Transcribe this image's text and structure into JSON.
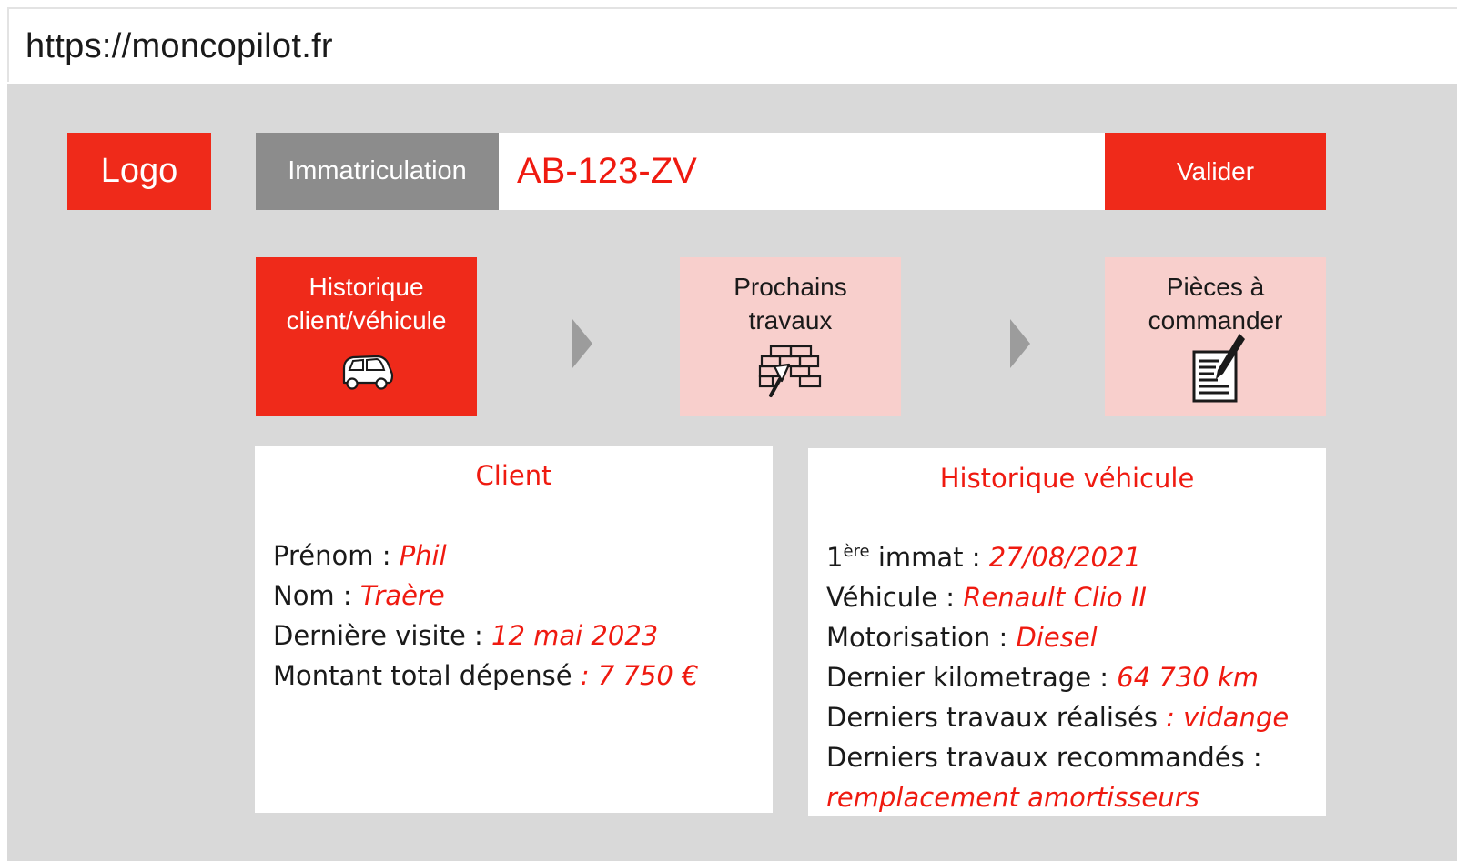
{
  "browser": {
    "url": "https://moncopilot.fr"
  },
  "header": {
    "logo_label": "Logo",
    "immat_label": "Immatriculation",
    "immat_value": "AB-123-ZV",
    "validate_label": "Valider"
  },
  "steps": [
    {
      "label": "Historique\nclient/véhicule",
      "icon": "car-icon",
      "active": true
    },
    {
      "label": "Prochains\ntravaux",
      "icon": "brick-wall-trowel-icon",
      "active": false
    },
    {
      "label": "Pièces à\ncommander",
      "icon": "document-pen-icon",
      "active": false
    }
  ],
  "client": {
    "title": "Client",
    "prenom_label": "Prénom : ",
    "prenom_value": "Phil",
    "nom_label": "Nom : ",
    "nom_value": "Traère",
    "visite_label": "Dernière visite : ",
    "visite_value": "12 mai 2023",
    "montant_label": "Montant total dépensé ",
    "montant_value": ": 7 750 €"
  },
  "vehicule": {
    "title": "Historique véhicule",
    "immat_prefix": "1",
    "immat_sup": "ère",
    "immat_label": " immat : ",
    "immat_value": "27/08/2021",
    "vehicule_label": "Véhicule : ",
    "vehicule_value": "Renault Clio II",
    "motorisation_label": "Motorisation : ",
    "motorisation_value": "Diesel",
    "km_label": "Dernier kilometrage : ",
    "km_value": "64 730 km",
    "travaux_label": "Derniers travaux réalisés ",
    "travaux_value": ": vidange",
    "recommandes_label": "Derniers travaux recommandés :",
    "recommandes_value": "remplacement amortisseurs"
  },
  "colors": {
    "accent": "#ef2a1a",
    "accent_light": "#f8cfcc",
    "label_gray": "#8c8c8c",
    "canvas": "#d9d9d9"
  }
}
